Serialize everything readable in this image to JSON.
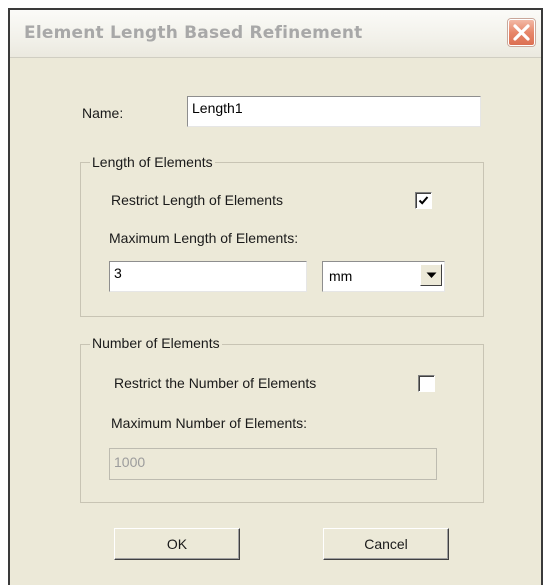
{
  "window": {
    "title": "Element Length Based Refinement"
  },
  "name_row": {
    "label": "Name:",
    "value": "Length1"
  },
  "length_group": {
    "caption": "Length of Elements",
    "restrict_label": "Restrict Length of Elements",
    "restrict_checked": true,
    "max_label": "Maximum Length of Elements:",
    "max_value": "3",
    "unit_selected": "mm"
  },
  "number_group": {
    "caption": "Number of Elements",
    "restrict_label": "Restrict the Number of Elements",
    "restrict_checked": false,
    "max_label": "Maximum Number of  Elements:",
    "max_value": "1000"
  },
  "buttons": {
    "ok_label": "OK",
    "cancel_label": "Cancel"
  },
  "icons": {
    "close": "close-icon",
    "check": "checkmark-icon",
    "dropdown": "chevron-down-icon"
  },
  "colors": {
    "dialog_background": "#ece9d8",
    "close_button": "#e7876a",
    "title_text": "#a8a8a8"
  }
}
